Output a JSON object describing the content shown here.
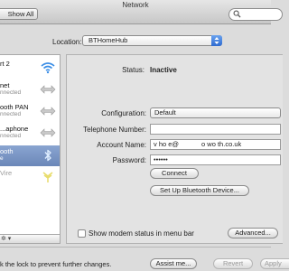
{
  "window": {
    "title": "Network"
  },
  "toolbar": {
    "show_all_label": "Show All"
  },
  "location": {
    "label": "Location:",
    "value": "BTHomeHub"
  },
  "sidebar": {
    "items": [
      {
        "name": "rt 2",
        "status": "",
        "icon": "wifi-icon",
        "selected": false,
        "dim": false
      },
      {
        "name": "net",
        "status": "nnected",
        "icon": "ethernet-arrows-icon",
        "selected": false,
        "dim": false
      },
      {
        "name": "ooth PAN",
        "status": "nnected",
        "icon": "ethernet-arrows-icon",
        "selected": false,
        "dim": false
      },
      {
        "name": "...aphone",
        "status": "nnected",
        "icon": "ethernet-arrows-icon",
        "selected": false,
        "dim": false
      },
      {
        "name": "ooth",
        "status": "e",
        "icon": "bluetooth-icon",
        "selected": true,
        "dim": false
      },
      {
        "name": "Vire",
        "status": "",
        "icon": "firewire-icon",
        "selected": false,
        "dim": true
      }
    ],
    "gear_label": "✲ ▾"
  },
  "detail": {
    "status_label": "Status:",
    "status_value": "Inactive",
    "configuration_label": "Configuration:",
    "configuration_value": "Default",
    "telephone_label": "Telephone Number:",
    "telephone_value": "",
    "account_label": "Account Name:",
    "account_value": "v   ho  e@            o   wo  th.co.uk",
    "password_label": "Password:",
    "password_value": "••••••",
    "connect_label": "Connect",
    "setup_label": "Set Up Bluetooth Device...",
    "modem_checkbox_label": "Show modem status in menu bar",
    "advanced_label": "Advanced...",
    "help_label": "?"
  },
  "footer": {
    "lock_text": "k the lock to prevent further changes.",
    "assist_label": "Assist me...",
    "revert_label": "Revert",
    "apply_label": "Apply"
  },
  "colors": {
    "accent": "#3a76d6",
    "selection": "#7892c2",
    "wifi": "#3b8ee6",
    "bluetooth": "#8cb7ea"
  }
}
